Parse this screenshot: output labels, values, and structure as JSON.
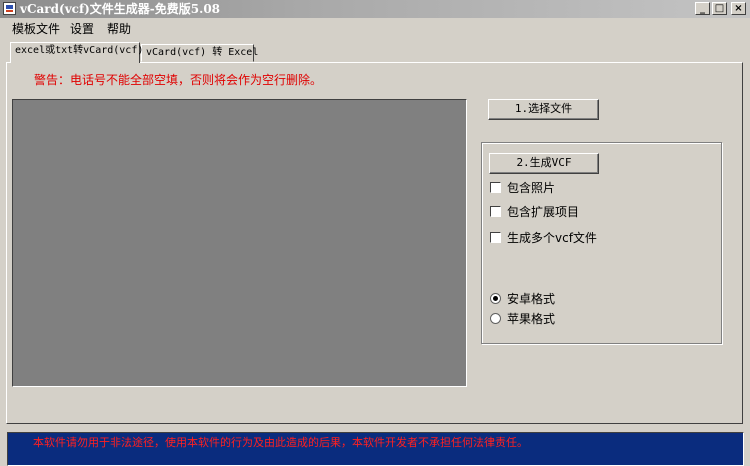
{
  "window": {
    "title": "vCard(vcf)文件生成器-免费版5.08",
    "controls": [
      "_",
      "□",
      "×"
    ]
  },
  "menu": [
    "模板文件",
    "设置",
    "帮助"
  ],
  "tabs": [
    {
      "label": "excel或txt转vCard(vcf)",
      "active": true
    },
    {
      "label": "vCard(vcf) 转 Excel",
      "active": false
    }
  ],
  "main": {
    "warning": "警告：电话号不能全部空填，否则将会作为空行删除。",
    "select_file_button": "1.选择文件",
    "generate_button": "2.生成VCF",
    "options": {
      "include_photo": {
        "label": "包含照片",
        "checked": false
      },
      "include_extended": {
        "label": "包含扩展项目",
        "checked": false
      },
      "multiple_files": {
        "label": "生成多个vcf文件",
        "checked": false
      }
    },
    "format": {
      "android": {
        "label": "安卓格式",
        "selected": true
      },
      "apple": {
        "label": "苹果格式",
        "selected": false
      }
    }
  },
  "status": {
    "disclaimer": "本软件请勿用于非法途径，使用本软件的行为及由此造成的后果，本软件开发者不承担任何法律责任。"
  },
  "colors": {
    "window_bg": "#d4d0c8",
    "preview_bg": "#808080",
    "status_bg": "#0a2c7e",
    "warning_text": "#e00000"
  }
}
